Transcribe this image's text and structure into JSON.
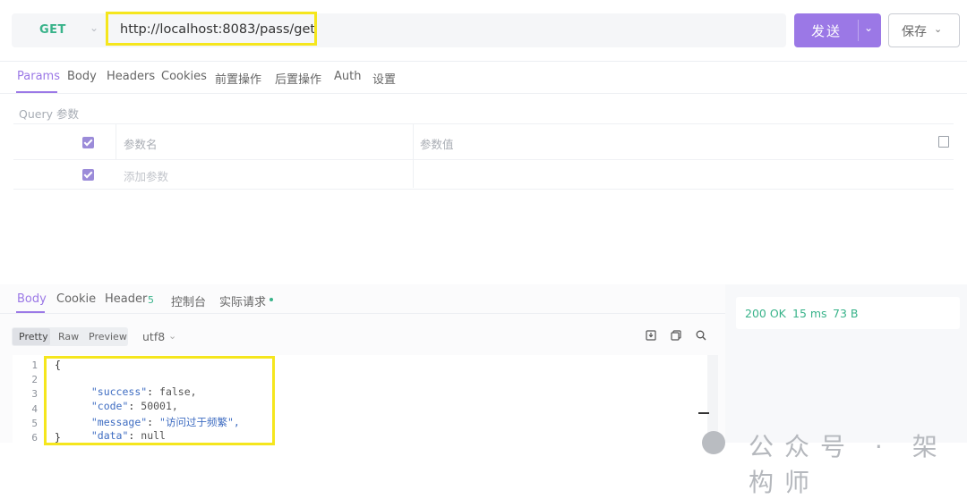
{
  "request": {
    "method": "GET",
    "url": "http://localhost:8083/pass/get",
    "send_label": "发送",
    "save_label": "保存"
  },
  "request_tabs": [
    "Params",
    "Body",
    "Headers",
    "Cookies",
    "前置操作",
    "后置操作",
    "Auth",
    "设置"
  ],
  "query": {
    "section_label": "Query 参数",
    "header_name": "参数名",
    "header_value": "参数值",
    "add_param_placeholder": "添加参数"
  },
  "response_tabs": {
    "body": "Body",
    "cookie": "Cookie",
    "header": "Header",
    "header_count": "5",
    "console": "控制台",
    "actual_request": "实际请求"
  },
  "response_stats": {
    "status": "200 OK",
    "time": "15 ms",
    "size": "73 B"
  },
  "format": {
    "options": [
      "Pretty",
      "Raw",
      "Preview"
    ],
    "selected": "Pretty",
    "encoding": "utf8"
  },
  "response_body": {
    "line_numbers": [
      "1",
      "2",
      "3",
      "4",
      "5",
      "6"
    ],
    "open_brace": "{",
    "close_brace": "}",
    "fields": [
      {
        "key": "\"success\"",
        "value": "false,"
      },
      {
        "key": "\"code\"",
        "value": "50001,"
      },
      {
        "key": "\"message\"",
        "value": "\"访问过于频繁\","
      },
      {
        "key": "\"data\"",
        "value": "null"
      }
    ]
  },
  "watermark": "公众号 · 架构师",
  "colors": {
    "accent": "#9b78e6",
    "success_green": "#39b38a",
    "highlight_yellow": "#f5e61d"
  }
}
